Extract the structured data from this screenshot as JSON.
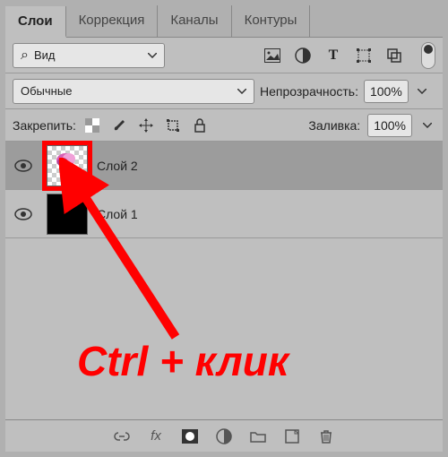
{
  "tabs": {
    "layers": "Слои",
    "adjustments": "Коррекция",
    "channels": "Каналы",
    "paths": "Контуры"
  },
  "view_dropdown": {
    "search_glyph": "⌕",
    "label": "Вид"
  },
  "blend_mode": {
    "label": "Обычные"
  },
  "opacity": {
    "label": "Непрозрачность:",
    "value": "100%"
  },
  "fill": {
    "label": "Заливка:",
    "value": "100%"
  },
  "lock": {
    "label": "Закрепить:"
  },
  "layers": [
    {
      "name": "Слой 2",
      "selected": true,
      "thumb": "flower"
    },
    {
      "name": "Слой 1",
      "selected": false,
      "thumb": "black"
    }
  ],
  "annotation": {
    "text": "Ctrl + клик"
  },
  "icons": {
    "image": "image-icon",
    "circle_half": "adjust-icon",
    "text": "type-icon",
    "transform": "transform-icon",
    "artboard": "artboard-icon",
    "lock_trans": "lock-transparency-icon",
    "brush": "brush-icon",
    "move": "move-icon",
    "crop": "crop-icon",
    "lock": "lock-icon",
    "link": "link-icon",
    "fx": "fx-icon",
    "mask": "mask-icon",
    "adjust": "adjustment-icon",
    "group": "group-icon",
    "new": "new-layer-icon",
    "trash": "trash-icon",
    "eye": "eye-icon"
  }
}
